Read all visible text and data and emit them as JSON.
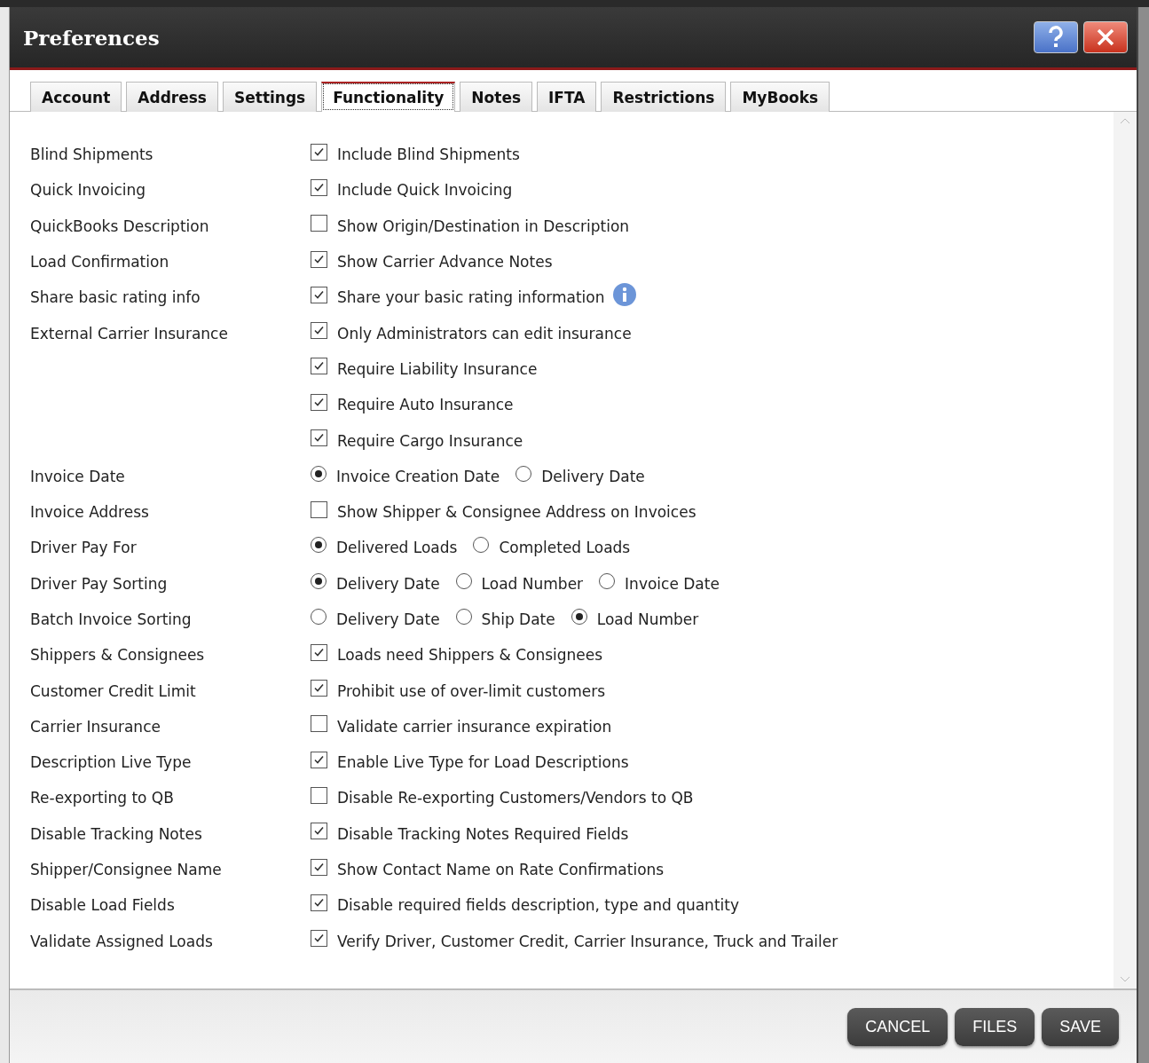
{
  "window": {
    "title": "Preferences"
  },
  "tabs": [
    {
      "label": "Account",
      "selected": false
    },
    {
      "label": "Address",
      "selected": false
    },
    {
      "label": "Settings",
      "selected": false
    },
    {
      "label": "Functionality",
      "selected": true
    },
    {
      "label": "Notes",
      "selected": false
    },
    {
      "label": "IFTA",
      "selected": false
    },
    {
      "label": "Restrictions",
      "selected": false
    },
    {
      "label": "MyBooks",
      "selected": false
    }
  ],
  "rows": [
    {
      "label": "Blind Shipments",
      "options": [
        {
          "kind": "checkbox",
          "text": "Include Blind Shipments",
          "checked": true
        }
      ]
    },
    {
      "label": "Quick Invoicing",
      "options": [
        {
          "kind": "checkbox",
          "text": "Include Quick Invoicing",
          "checked": true
        }
      ]
    },
    {
      "label": "QuickBooks Description",
      "options": [
        {
          "kind": "checkbox",
          "text": "Show Origin/Destination in Description",
          "checked": false
        }
      ]
    },
    {
      "label": "Load Confirmation",
      "options": [
        {
          "kind": "checkbox",
          "text": "Show Carrier Advance Notes",
          "checked": true
        }
      ]
    },
    {
      "label": "Share basic rating info",
      "info_icon": true,
      "options": [
        {
          "kind": "checkbox",
          "text": "Share your basic rating information",
          "checked": true
        }
      ]
    },
    {
      "label": "External Carrier Insurance",
      "options": [
        {
          "kind": "checkbox",
          "text": "Only Administrators can edit insurance",
          "checked": true
        }
      ]
    },
    {
      "options": [
        {
          "kind": "checkbox",
          "text": "Require Liability Insurance",
          "checked": true
        }
      ]
    },
    {
      "options": [
        {
          "kind": "checkbox",
          "text": "Require Auto Insurance",
          "checked": true
        }
      ]
    },
    {
      "options": [
        {
          "kind": "checkbox",
          "text": "Require Cargo Insurance",
          "checked": true
        }
      ]
    },
    {
      "label": "Invoice Date",
      "options": [
        {
          "kind": "radio",
          "text": "Invoice Creation Date",
          "selected": true
        },
        {
          "kind": "radio",
          "text": "Delivery Date",
          "selected": false
        }
      ]
    },
    {
      "label": "Invoice Address",
      "options": [
        {
          "kind": "checkbox",
          "text": "Show Shipper & Consignee Address on Invoices",
          "checked": false
        }
      ]
    },
    {
      "label": "Driver Pay For",
      "options": [
        {
          "kind": "radio",
          "text": "Delivered Loads",
          "selected": true
        },
        {
          "kind": "radio",
          "text": "Completed Loads",
          "selected": false
        }
      ]
    },
    {
      "label": "Driver Pay Sorting",
      "options": [
        {
          "kind": "radio",
          "text": "Delivery Date",
          "selected": true
        },
        {
          "kind": "radio",
          "text": "Load Number",
          "selected": false
        },
        {
          "kind": "radio",
          "text": "Invoice Date",
          "selected": false
        }
      ]
    },
    {
      "label": "Batch Invoice Sorting",
      "options": [
        {
          "kind": "radio",
          "text": "Delivery Date",
          "selected": false
        },
        {
          "kind": "radio",
          "text": "Ship Date",
          "selected": false
        },
        {
          "kind": "radio",
          "text": "Load Number",
          "selected": true
        }
      ]
    },
    {
      "label": "Shippers & Consignees",
      "options": [
        {
          "kind": "checkbox",
          "text": "Loads need Shippers & Consignees",
          "checked": true
        }
      ]
    },
    {
      "label": "Customer Credit Limit",
      "options": [
        {
          "kind": "checkbox",
          "text": "Prohibit use of over-limit customers",
          "checked": true
        }
      ]
    },
    {
      "label": "Carrier Insurance",
      "options": [
        {
          "kind": "checkbox",
          "text": "Validate carrier insurance expiration",
          "checked": false
        }
      ]
    },
    {
      "label": "Description Live Type",
      "options": [
        {
          "kind": "checkbox",
          "text": "Enable Live Type for Load Descriptions",
          "checked": true
        }
      ]
    },
    {
      "label": "Re-exporting to QB",
      "options": [
        {
          "kind": "checkbox",
          "text": "Disable Re-exporting Customers/Vendors to QB",
          "checked": false
        }
      ]
    },
    {
      "label": "Disable Tracking Notes",
      "options": [
        {
          "kind": "checkbox",
          "text": "Disable Tracking Notes Required Fields",
          "checked": true
        }
      ]
    },
    {
      "label": "Shipper/Consignee Name",
      "options": [
        {
          "kind": "checkbox",
          "text": "Show Contact Name on Rate Confirmations",
          "checked": true
        }
      ]
    },
    {
      "label": "Disable Load Fields",
      "options": [
        {
          "kind": "checkbox",
          "text": "Disable required fields description, type and quantity",
          "checked": true
        }
      ]
    },
    {
      "label": "Validate Assigned Loads",
      "options": [
        {
          "kind": "checkbox",
          "text": "Verify Driver, Customer Credit, Carrier Insurance, Truck and Trailer",
          "checked": true
        }
      ]
    }
  ],
  "buttons": [
    "CANCEL",
    "FILES",
    "SAVE"
  ]
}
